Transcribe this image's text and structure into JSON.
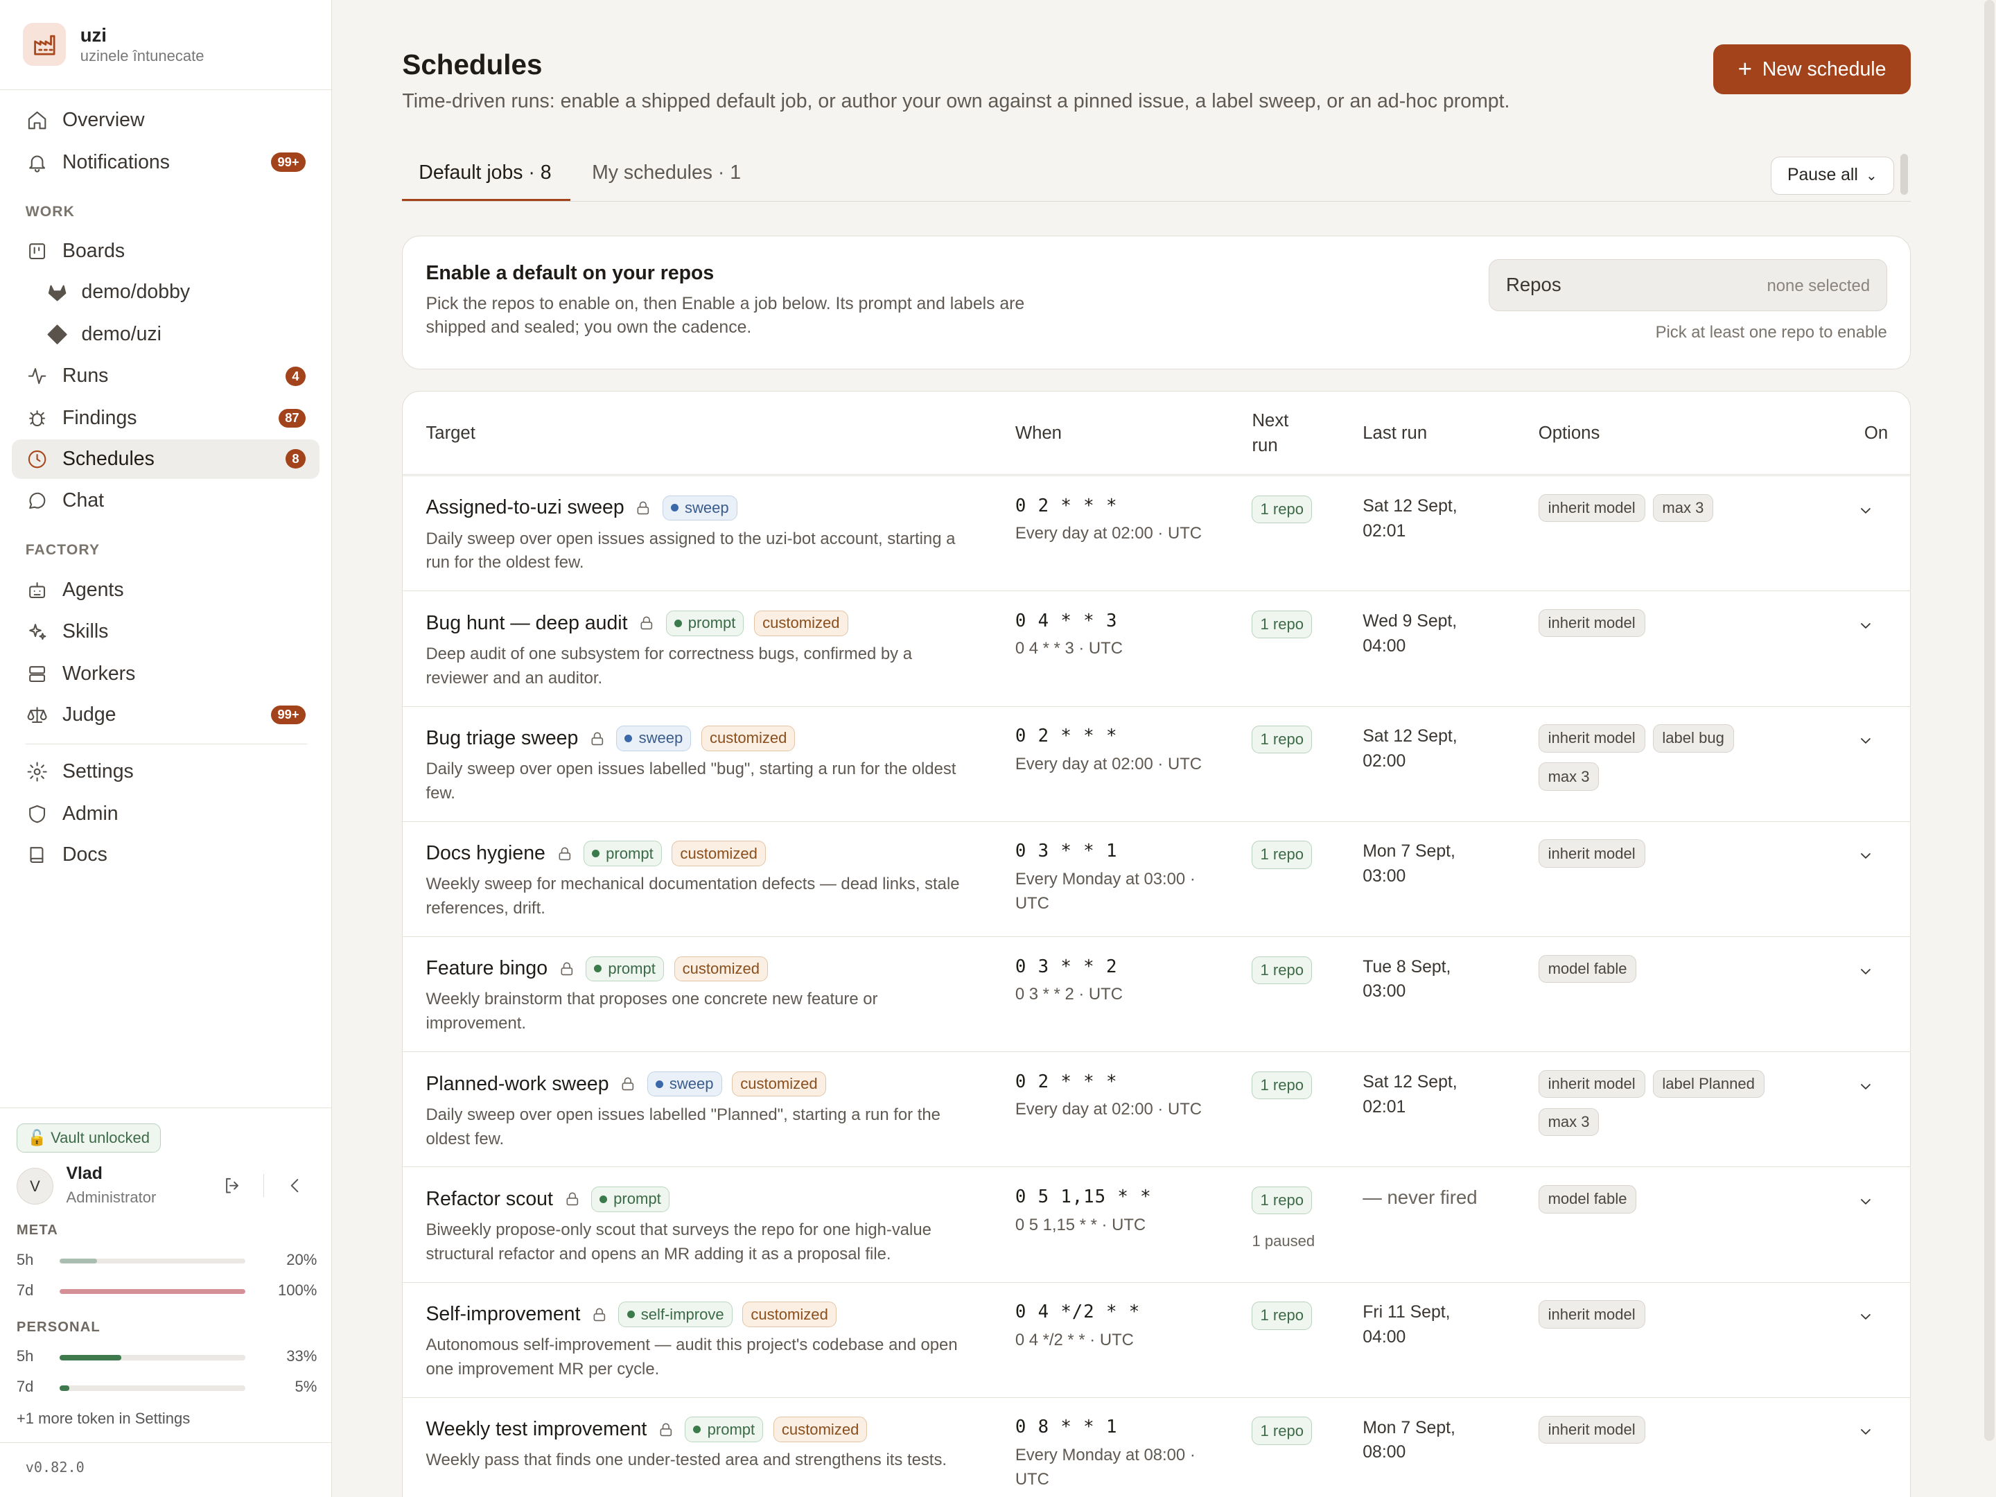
{
  "brand": {
    "name": "uzi",
    "subtitle": "uzinele întunecate"
  },
  "nav": {
    "overview": "Overview",
    "notifications": {
      "label": "Notifications",
      "badge": "99+"
    },
    "work_section": "WORK",
    "boards": "Boards",
    "board_dobby": "demo/dobby",
    "board_uzi": "demo/uzi",
    "runs": {
      "label": "Runs",
      "badge": "4"
    },
    "findings": {
      "label": "Findings",
      "badge": "87"
    },
    "schedules": {
      "label": "Schedules",
      "badge": "8"
    },
    "chat": "Chat",
    "factory_section": "FACTORY",
    "agents": "Agents",
    "skills": "Skills",
    "workers": "Workers",
    "judge": {
      "label": "Judge",
      "badge": "99+"
    },
    "settings": "Settings",
    "admin": "Admin",
    "docs": "Docs"
  },
  "footer": {
    "vault": "🔓 Vault unlocked",
    "user": {
      "initial": "V",
      "name": "Vlad",
      "role": "Administrator"
    },
    "meta_label": "META",
    "meta": [
      {
        "name": "5h",
        "pct": "20%",
        "value": 0.2,
        "color": "#a9bdb0"
      },
      {
        "name": "7d",
        "pct": "100%",
        "value": 1.0,
        "color": "#d48f97"
      }
    ],
    "personal_label": "PERSONAL",
    "personal": [
      {
        "name": "5h",
        "pct": "33%",
        "value": 0.33,
        "color": "#3e7a4e"
      },
      {
        "name": "7d",
        "pct": "5%",
        "value": 0.05,
        "color": "#3e7a4e"
      }
    ],
    "more_token": "+1 more token in Settings",
    "version": "v0.82.0"
  },
  "header": {
    "title": "Schedules",
    "subtitle": "Time-driven runs: enable a shipped default job, or author your own against a pinned issue, a label sweep, or an ad-hoc prompt.",
    "new_button": "New schedule"
  },
  "tabs": {
    "default": "Default jobs · 8",
    "mine": "My schedules · 1",
    "pause_all": "Pause all"
  },
  "enable": {
    "title": "Enable a default on your repos",
    "description": "Pick the repos to enable on, then Enable a job below. Its prompt and labels are shipped and sealed; you own the cadence.",
    "repos_label": "Repos",
    "repos_value": "none selected",
    "hint": "Pick at least one repo to enable"
  },
  "table": {
    "headers": {
      "target": "Target",
      "when": "When",
      "next": "Next run",
      "last": "Last run",
      "options": "Options",
      "on": "On"
    },
    "rows": [
      {
        "name": "Assigned-to-uzi sweep",
        "kind": "sweep",
        "kind_class": "b-sweep",
        "customized": false,
        "desc": "Daily sweep over open issues assigned to the uzi-bot account, starting a run for the oldest few.",
        "cron": "0 2 * * *",
        "when": "Every day at 02:00 · UTC",
        "next": "1 repo",
        "paused": "",
        "last": "Sat 12 Sept, 02:01",
        "options": [
          "inherit model",
          "max 3"
        ]
      },
      {
        "name": "Bug hunt — deep audit",
        "kind": "prompt",
        "kind_class": "b-prompt",
        "customized": true,
        "desc": "Deep audit of one subsystem for correctness bugs, confirmed by a reviewer and an auditor.",
        "cron": "0 4 * * 3",
        "when": "0 4 * * 3 · UTC",
        "next": "1 repo",
        "paused": "",
        "last": "Wed 9 Sept, 04:00",
        "options": [
          "inherit model"
        ]
      },
      {
        "name": "Bug triage sweep",
        "kind": "sweep",
        "kind_class": "b-sweep",
        "customized": true,
        "desc": "Daily sweep over open issues labelled \"bug\", starting a run for the oldest few.",
        "cron": "0 2 * * *",
        "when": "Every day at 02:00 · UTC",
        "next": "1 repo",
        "paused": "",
        "last": "Sat 12 Sept, 02:00",
        "options": [
          "inherit model",
          "label bug",
          "max 3"
        ]
      },
      {
        "name": "Docs hygiene",
        "kind": "prompt",
        "kind_class": "b-prompt",
        "customized": true,
        "desc": "Weekly sweep for mechanical documentation defects — dead links, stale references, drift.",
        "cron": "0 3 * * 1",
        "when": "Every Monday at 03:00 · UTC",
        "next": "1 repo",
        "paused": "",
        "last": "Mon 7 Sept, 03:00",
        "options": [
          "inherit model"
        ]
      },
      {
        "name": "Feature bingo",
        "kind": "prompt",
        "kind_class": "b-prompt",
        "customized": true,
        "desc": "Weekly brainstorm that proposes one concrete new feature or improvement.",
        "cron": "0 3 * * 2",
        "when": "0 3 * * 2 · UTC",
        "next": "1 repo",
        "paused": "",
        "last": "Tue 8 Sept, 03:00",
        "options": [
          "model fable"
        ]
      },
      {
        "name": "Planned-work sweep",
        "kind": "sweep",
        "kind_class": "b-sweep",
        "customized": true,
        "desc": "Daily sweep over open issues labelled \"Planned\", starting a run for the oldest few.",
        "cron": "0 2 * * *",
        "when": "Every day at 02:00 · UTC",
        "next": "1 repo",
        "paused": "",
        "last": "Sat 12 Sept, 02:01",
        "options": [
          "inherit model",
          "label Planned",
          "max 3"
        ]
      },
      {
        "name": "Refactor scout",
        "kind": "prompt",
        "kind_class": "b-prompt",
        "customized": false,
        "desc": "Biweekly propose-only scout that surveys the repo for one high-value structural refactor and opens an MR adding it as a proposal file.",
        "cron": "0 5 1,15 * *",
        "when": "0 5 1,15 * * · UTC",
        "next": "1 repo",
        "paused": "1 paused",
        "last": "— never fired",
        "options": [
          "model fable"
        ]
      },
      {
        "name": "Self-improvement",
        "kind": "self-improve",
        "kind_class": "b-self",
        "customized": true,
        "desc": "Autonomous self-improvement — audit this project's codebase and open one improvement MR per cycle.",
        "cron": "0 4 */2 * *",
        "when": "0 4 */2 * * · UTC",
        "next": "1 repo",
        "paused": "",
        "last": "Fri 11 Sept, 04:00",
        "options": [
          "inherit model"
        ]
      },
      {
        "name": "Weekly test improvement",
        "kind": "prompt",
        "kind_class": "b-prompt",
        "customized": true,
        "desc": "Weekly pass that finds one under-tested area and strengthens its tests.",
        "cron": "0 8 * * 1",
        "when": "Every Monday at 08:00 · UTC",
        "next": "1 repo",
        "paused": "",
        "last": "Mon 7 Sept, 08:00",
        "options": [
          "inherit model"
        ]
      }
    ],
    "customized_label": "customized"
  }
}
